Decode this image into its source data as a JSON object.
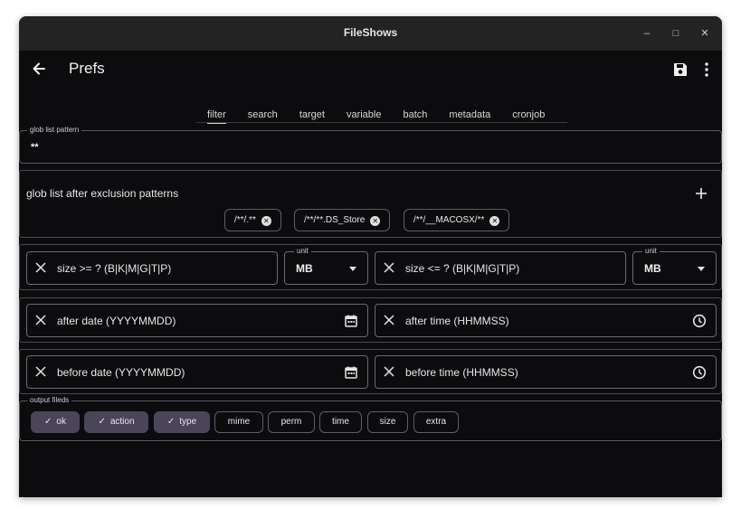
{
  "window": {
    "title": "FileShows"
  },
  "appbar": {
    "title": "Prefs"
  },
  "tabs": [
    "filter",
    "search",
    "target",
    "variable",
    "batch",
    "metadata",
    "cronjob"
  ],
  "glob_list": {
    "legend": "glob list pattern",
    "value": "**"
  },
  "exclusion": {
    "title": "glob list after exclusion patterns",
    "patterns": [
      "/**/.**",
      "/**/**.DS_Store",
      "/**/__MACOSX/**"
    ]
  },
  "size": {
    "min_label": "size >= ? (B|K|M|G|T|P)",
    "max_label": "size <= ? (B|K|M|G|T|P)",
    "unit_legend": "unit",
    "min_unit": "MB",
    "max_unit": "MB"
  },
  "after": {
    "date_label": "after date (YYYYMMDD)",
    "time_label": "after time (HHMMSS)"
  },
  "before": {
    "date_label": "before date (YYYYMMDD)",
    "time_label": "before time (HHMMSS)"
  },
  "output": {
    "legend": "output fileds",
    "fields": [
      {
        "label": "ok",
        "selected": true
      },
      {
        "label": "action",
        "selected": true
      },
      {
        "label": "type",
        "selected": true
      },
      {
        "label": "mime",
        "selected": false
      },
      {
        "label": "perm",
        "selected": false
      },
      {
        "label": "time",
        "selected": false
      },
      {
        "label": "size",
        "selected": false
      },
      {
        "label": "extra",
        "selected": false
      }
    ]
  },
  "colors": {
    "background": "#0c0b0e",
    "titlebar": "#232323",
    "chip_selected": "#4a4558",
    "outline": "#6b6b70"
  }
}
